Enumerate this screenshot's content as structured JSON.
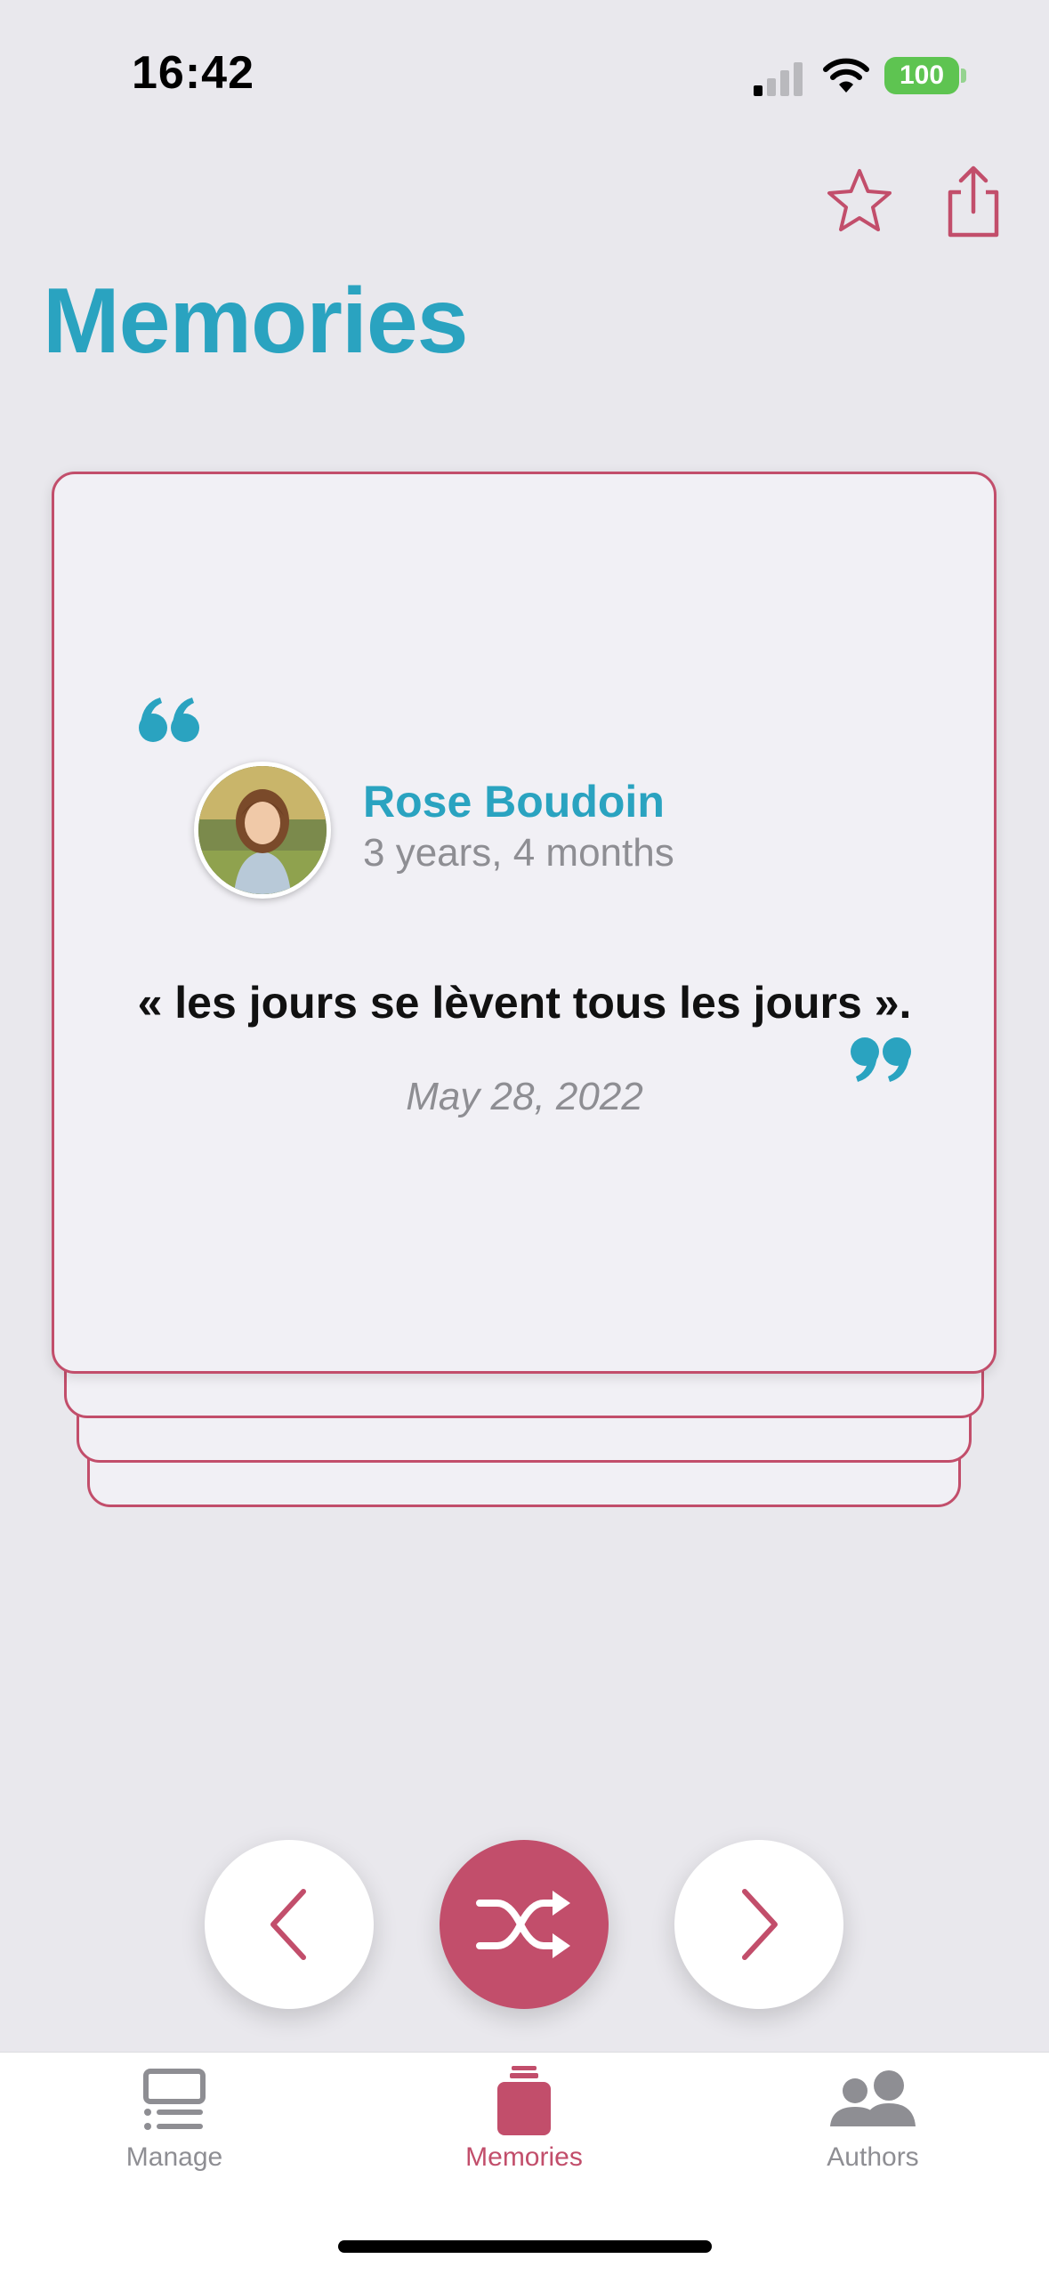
{
  "status_bar": {
    "time": "16:42",
    "battery": "100"
  },
  "header": {
    "title": "Memories",
    "actions": [
      "star-icon",
      "share-icon"
    ]
  },
  "memory": {
    "author_name": "Rose Boudoin",
    "author_age": "3 years, 4 months",
    "quote": "« les jours se lèvent tous les jours ».",
    "date": "May 28, 2022"
  },
  "controls": {
    "previous": "chevron-left-icon",
    "shuffle": "shuffle-icon",
    "next": "chevron-right-icon"
  },
  "tabs": [
    {
      "label": "Manage",
      "icon": "list-icon",
      "active": false
    },
    {
      "label": "Memories",
      "icon": "jar-icon",
      "active": true
    },
    {
      "label": "Authors",
      "icon": "people-icon",
      "active": false
    }
  ],
  "colors": {
    "accent": "#c24e6b",
    "title": "#2aa3c0",
    "background": "#e9e8ed",
    "card": "#f1f0f5"
  }
}
